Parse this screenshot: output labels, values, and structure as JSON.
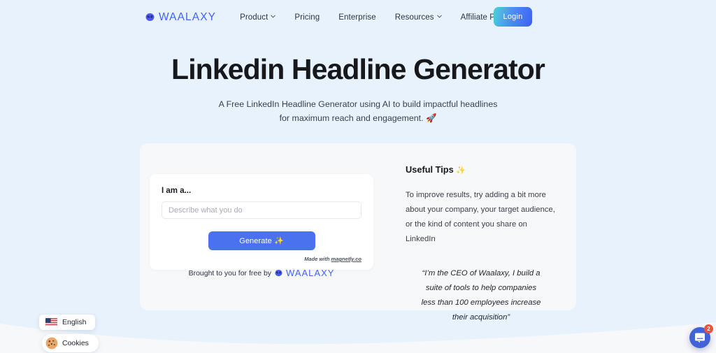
{
  "nav": {
    "brand": "WAALAXY",
    "brand_icon": "alien-icon",
    "links": [
      {
        "label": "Product",
        "has_caret": true
      },
      {
        "label": "Pricing",
        "has_caret": false
      },
      {
        "label": "Enterprise",
        "has_caret": false
      },
      {
        "label": "Resources",
        "has_caret": true
      },
      {
        "label": "Affiliate Program",
        "has_caret": false
      }
    ],
    "login_label": "Login"
  },
  "hero": {
    "title": "Linkedin Headline Generator",
    "subtitle_line1": "A Free LinkedIn Headline Generator using AI to build impactful headlines",
    "subtitle_line2": "for maximum reach and engagement. 🚀"
  },
  "form": {
    "label": "I am a...",
    "placeholder": "Describe what you do",
    "value": "",
    "generate_label": "Generate ✨",
    "made_with_prefix": "Made with ",
    "made_with_link": "magnetly.co"
  },
  "footer": {
    "brought_text": "Brought to you for free by",
    "brand": "WAALAXY"
  },
  "tips": {
    "title": "Useful Tips",
    "title_sparkle": "✨",
    "body_line1": "To improve results, try adding a bit more",
    "body_line2": "about your company, your target audience,",
    "body_line3": "or the kind of content you share on LinkedIn",
    "quote_line1": "“I’m the CEO of Waalaxy, I build a",
    "quote_line2": "suite of tools to help companies",
    "quote_line3": "less than 100 employees increase",
    "quote_line4": "their acquisition”"
  },
  "widgets": {
    "language_label": "English",
    "language_icon": "us-flag-icon",
    "cookies_label": "Cookies",
    "cookies_icon": "cookie-icon",
    "chat_icon": "chat-bubble-icon",
    "chat_badge_count": "2"
  },
  "colors": {
    "page_background": "#e8f2fd",
    "brand_blue": "#4262ff",
    "button_blue": "#4a72ee",
    "accent_orange": "#f3a23c",
    "badge_red": "#e8543f",
    "panel_background": "#f7f8fa"
  }
}
